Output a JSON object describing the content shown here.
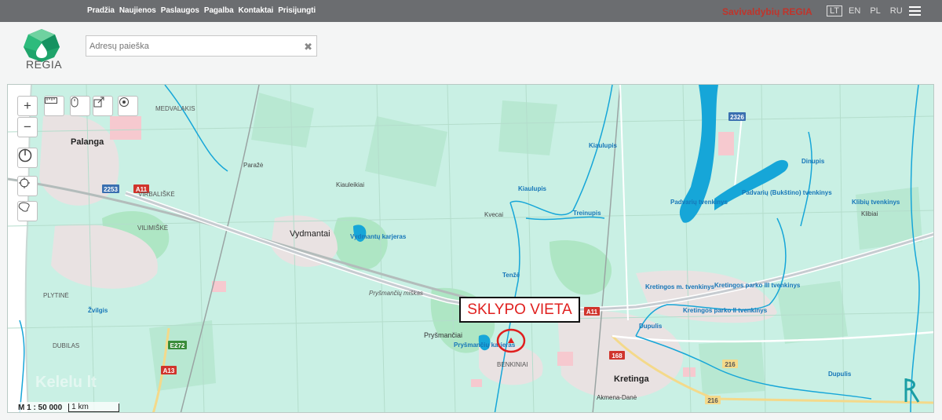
{
  "nav": {
    "items": [
      "Pradžia",
      "Naujienos",
      "Paslaugos",
      "Pagalba",
      "Kontaktai",
      "Prisijungti"
    ],
    "brand": "Savivaldybių REGIA",
    "languages": [
      "LT",
      "EN",
      "PL",
      "RU"
    ],
    "active_language": "LT"
  },
  "logo": {
    "text": "REGIA"
  },
  "search": {
    "placeholder": "Adresų paieška",
    "value": ""
  },
  "map": {
    "scale_ratio": "M 1 : 50 000",
    "scale_bar": "1 km",
    "site_label": "SKLYPO VIETA",
    "places": {
      "palanga": "Palanga",
      "medvalakis": "MEDVALAKIS",
      "virbaliske": "VIRBALIŠKĖ",
      "vilimiske": "VILIMIŠKĖ",
      "vydmantai": "Vydmantai",
      "kiauleikiai": "Kiauleikiai",
      "paraze": "Paražė",
      "kvecai": "Kvecai",
      "prysmanciai": "Pryšmančiai",
      "prysmanciu_miskas": "Pryšmančių miškas",
      "benkiniai": "BENKINIAI",
      "kretinga": "Kretinga",
      "akmena_dane": "Akmena-Danė",
      "klibiai": "Klibiai",
      "plytine": "PLYTINĖ",
      "dubilas": "DUBILAS"
    },
    "water": {
      "vydmantu_karjeras": "Vydmantų karjeras",
      "prysmanciu_karjeras": "Pryšmančių karjeras",
      "kiaulupis": "Kiaulupis",
      "kiaulupis_2": "Kiaulupis",
      "treinupis": "Treinupis",
      "tenze": "Tenžė",
      "dinupis": "Dinupis",
      "padvariu_tvenkinys": "Padvarių tvenkinys",
      "padvariu_bukstino_tvenkinys": "Padvarių (Bukštino) tvenkinys",
      "klibiu_tvenkinys": "Klibių tvenkinys",
      "kretingos_tvenkinys": "Kretingos m. tvenkinys",
      "kretingos_parko_ii": "Kretingos parko II tvenkinys",
      "kretingos_parko_iii": "Kretingos parko III tvenkinys",
      "dupulis": "Dupulis",
      "dupulis_2": "Dupulis",
      "zvilgis": "Žvilgis"
    },
    "roads": [
      "2253",
      "A11",
      "A11",
      "E272",
      "A13",
      "168",
      "216",
      "216",
      "2326"
    ],
    "watermark": "Kelelu lt"
  },
  "colors": {
    "topbar": "#6b6d70",
    "brand": "#c0342b",
    "map_bg": "#c9f0e4",
    "water": "#16a6d8",
    "water_label": "#1676b8",
    "site_marker": "#e0201f"
  }
}
